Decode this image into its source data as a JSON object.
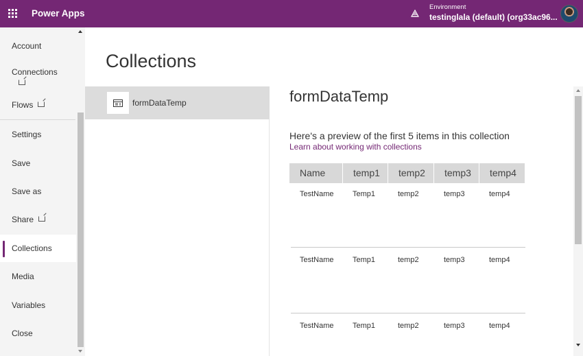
{
  "header": {
    "app_title": "Power Apps",
    "environment_label": "Environment",
    "environment_name": "testinglala (default) (org33ac96...",
    "brand_color": "#742774",
    "icons": {
      "waffle": "waffle-icon",
      "environment": "environment-icon",
      "avatar": "user-avatar"
    }
  },
  "nav": {
    "items": [
      {
        "label": "Account"
      },
      {
        "label": "Connections",
        "external": true
      },
      {
        "label": "Flows",
        "external": true
      },
      {
        "label": "Settings"
      },
      {
        "label": "Save"
      },
      {
        "label": "Save as"
      },
      {
        "label": "Share",
        "external": true
      },
      {
        "label": "Collections",
        "selected": true
      },
      {
        "label": "Media"
      },
      {
        "label": "Variables"
      },
      {
        "label": "Close"
      }
    ]
  },
  "main": {
    "page_title": "Collections",
    "collections": [
      {
        "name": "formDataTemp",
        "icon": "table-icon",
        "selected": true
      }
    ],
    "detail": {
      "title": "formDataTemp",
      "preview_text": "Here's a preview of the first 5 items in this collection",
      "learn_link": "Learn about working with collections",
      "columns": [
        "Name",
        "temp1",
        "temp2",
        "temp3",
        "temp4"
      ],
      "rows": [
        [
          "TestName",
          "Temp1",
          "temp2",
          "temp3",
          "temp4"
        ],
        [
          "TestName",
          "Temp1",
          "temp2",
          "temp3",
          "temp4"
        ],
        [
          "TestName",
          "Temp1",
          "temp2",
          "temp3",
          "temp4"
        ]
      ]
    }
  }
}
